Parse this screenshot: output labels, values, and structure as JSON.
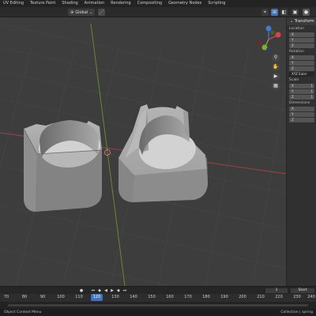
{
  "workspace_tabs": [
    "UV Editing",
    "Texture Paint",
    "Shading",
    "Animation",
    "Rendering",
    "Compositing",
    "Geometry Nodes",
    "Scripting"
  ],
  "header": {
    "orientation": "Global"
  },
  "sidebar": {
    "title": "Transform",
    "location_label": "Location",
    "rotation_label": "Rotation",
    "rotation_mode": "XYZ Euler",
    "scale_label": "Scale",
    "dimensions_label": "Dimensions",
    "axes": [
      "X",
      "Y",
      "Z"
    ],
    "scale_values": [
      "1",
      "1",
      "1"
    ]
  },
  "gizmo": {
    "x": "X",
    "y": "Y",
    "z": "Z"
  },
  "timeline": {
    "ticks": [
      "70",
      "80",
      "90",
      "100",
      "110",
      "120",
      "130",
      "140",
      "150",
      "160",
      "170",
      "180",
      "190",
      "200",
      "210",
      "220",
      "230",
      "240"
    ],
    "current_frame": "120",
    "frame_field": "1",
    "start_label": "Start"
  },
  "status": {
    "left": "Object Context Menu",
    "right": "Collection | spring"
  },
  "colors": {
    "accent": "#4772b3",
    "x_axis": "#d6434d",
    "y_axis": "#7fae2f",
    "z_axis": "#3d7bd6"
  }
}
